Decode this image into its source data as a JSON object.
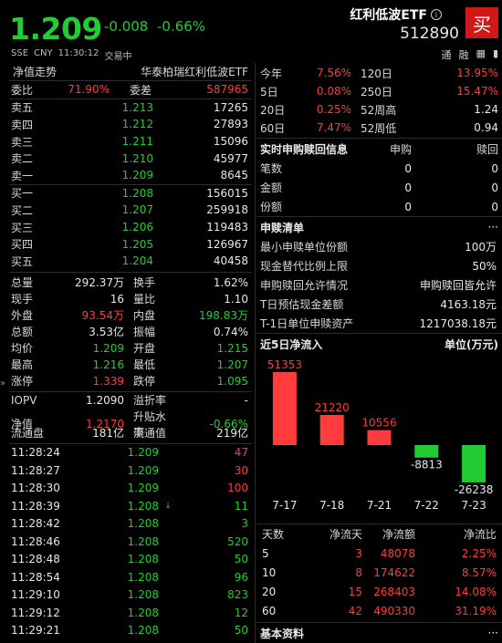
{
  "header": {
    "price": "1.209",
    "change": "-0.008",
    "change_pct": "-0.66%",
    "exchange": "SSE",
    "currency": "CNY",
    "time": "11:30:12",
    "status": "交易中",
    "name": "红利低波ETF",
    "code": "512890",
    "buy_label": "买",
    "icon_tong": "通",
    "icon_rong": "融",
    "up_color": "#ff3b3b",
    "down_color": "#22cc33"
  },
  "left": {
    "tab_title": "净值走势",
    "tab_fund": "华泰柏瑞红利低波ETF",
    "weibi_label": "委比",
    "weibi": "71.90%",
    "weicha_label": "委差",
    "weicha": "587965",
    "asks": [
      {
        "label": "卖五",
        "price": "1.213",
        "vol": "17265"
      },
      {
        "label": "卖四",
        "price": "1.212",
        "vol": "27893"
      },
      {
        "label": "卖三",
        "price": "1.211",
        "vol": "15096"
      },
      {
        "label": "卖二",
        "price": "1.210",
        "vol": "45977"
      },
      {
        "label": "卖一",
        "price": "1.209",
        "vol": "8645"
      }
    ],
    "bids": [
      {
        "label": "买一",
        "price": "1.208",
        "vol": "156015"
      },
      {
        "label": "买二",
        "price": "1.207",
        "vol": "259918"
      },
      {
        "label": "买三",
        "price": "1.206",
        "vol": "119483"
      },
      {
        "label": "买四",
        "price": "1.205",
        "vol": "126967"
      },
      {
        "label": "买五",
        "price": "1.204",
        "vol": "40458"
      }
    ],
    "stats": [
      {
        "l1": "总量",
        "v1": "292.37万",
        "c1": "white",
        "l2": "换手",
        "v2": "1.62%",
        "c2": "white"
      },
      {
        "l1": "现手",
        "v1": "16",
        "c1": "white",
        "l2": "量比",
        "v2": "1.10",
        "c2": "white"
      },
      {
        "l1": "外盘",
        "v1": "93.54万",
        "c1": "red",
        "l2": "内盘",
        "v2": "198.83万",
        "c2": "green"
      },
      {
        "l1": "总额",
        "v1": "3.53亿",
        "c1": "white",
        "l2": "振幅",
        "v2": "0.74%",
        "c2": "white"
      },
      {
        "l1": "均价",
        "v1": "1.209",
        "c1": "green",
        "l2": "开盘",
        "v2": "1.215",
        "c2": "green"
      },
      {
        "l1": "最高",
        "v1": "1.216",
        "c1": "green",
        "l2": "最低",
        "v2": "1.207",
        "c2": "green"
      },
      {
        "l1": "涨停",
        "v1": "1.339",
        "c1": "red",
        "l2": "跌停",
        "v2": "1.095",
        "c2": "green"
      }
    ],
    "stats2": [
      {
        "l1": "IOPV",
        "v1": "1.2090",
        "c1": "white",
        "l2": "溢折率",
        "v2": "-",
        "c2": "white"
      },
      {
        "l1": "净值",
        "v1": "1.2170",
        "c1": "red",
        "l2": "升贴水率",
        "v2": "-0.66%",
        "c2": "green"
      },
      {
        "l1": "流通盘",
        "v1": "181亿",
        "c1": "white",
        "l2": "流通值",
        "v2": "219亿",
        "c2": "white"
      }
    ],
    "ticks": [
      {
        "t": "11:28:24",
        "p": "1.209",
        "a": "",
        "v": "47",
        "vc": "red"
      },
      {
        "t": "11:28:27",
        "p": "1.209",
        "a": "",
        "v": "30",
        "vc": "red"
      },
      {
        "t": "11:28:30",
        "p": "1.209",
        "a": "",
        "v": "100",
        "vc": "red"
      },
      {
        "t": "11:28:39",
        "p": "1.208",
        "a": "↓",
        "v": "11",
        "vc": "green"
      },
      {
        "t": "11:28:42",
        "p": "1.208",
        "a": "",
        "v": "3",
        "vc": "green"
      },
      {
        "t": "11:28:46",
        "p": "1.208",
        "a": "",
        "v": "520",
        "vc": "green"
      },
      {
        "t": "11:28:48",
        "p": "1.208",
        "a": "",
        "v": "50",
        "vc": "green"
      },
      {
        "t": "11:28:54",
        "p": "1.208",
        "a": "",
        "v": "96",
        "vc": "green"
      },
      {
        "t": "11:29:10",
        "p": "1.208",
        "a": "",
        "v": "823",
        "vc": "green"
      },
      {
        "t": "11:29:12",
        "p": "1.208",
        "a": "",
        "v": "12",
        "vc": "green"
      },
      {
        "t": "11:29:21",
        "p": "1.208",
        "a": "",
        "v": "50",
        "vc": "green"
      }
    ]
  },
  "right": {
    "perf": [
      {
        "l1": "今年",
        "v1": "7.56%",
        "c1": "red",
        "l2": "120日",
        "v2": "13.95%",
        "c2": "red"
      },
      {
        "l1": "5日",
        "v1": "0.08%",
        "c1": "red",
        "l2": "250日",
        "v2": "15.47%",
        "c2": "red"
      },
      {
        "l1": "20日",
        "v1": "0.25%",
        "c1": "red",
        "l2": "52周高",
        "v2": "1.24",
        "c2": "white"
      },
      {
        "l1": "60日",
        "v1": "7.47%",
        "c1": "red",
        "l2": "52周低",
        "v2": "0.94",
        "c2": "white"
      }
    ],
    "sr_title": "实时申购赎回信息",
    "sr_col1": "申购",
    "sr_col2": "赎回",
    "sr_rows": [
      {
        "l": "笔数",
        "a": "0",
        "b": "0"
      },
      {
        "l": "金额",
        "a": "0",
        "b": "0"
      },
      {
        "l": "份额",
        "a": "0",
        "b": "0"
      }
    ],
    "list_title": "申赎清单",
    "list_more": "···",
    "list_rows": [
      {
        "k": "最小申赎单位份额",
        "v": "100万"
      },
      {
        "k": "现金替代比例上限",
        "v": "50%"
      },
      {
        "k": "申购赎回允许情况",
        "v": "申购赎回皆允许"
      },
      {
        "k": "T日预估现金差额",
        "v": "4163.18元"
      },
      {
        "k": "T-1日单位申赎资产",
        "v": "1217038.18元"
      }
    ],
    "flow_title": "近5日净流入",
    "flow_unit": "单位(万元)",
    "flow_table_head": [
      "天数",
      "净流天",
      "净流额",
      "净流比"
    ],
    "flow_table": [
      {
        "d": "5",
        "n": "3",
        "a": "48078",
        "p": "2.25%"
      },
      {
        "d": "10",
        "n": "8",
        "a": "174622",
        "p": "8.57%"
      },
      {
        "d": "20",
        "n": "15",
        "a": "268403",
        "p": "14.08%"
      },
      {
        "d": "60",
        "n": "42",
        "a": "490330",
        "p": "31.19%"
      }
    ],
    "basic_title": "基本资料",
    "basic_more": "···"
  },
  "chart_data": {
    "type": "bar",
    "title": "近5日净流入",
    "ylabel": "单位(万元)",
    "categories": [
      "7-17",
      "7-18",
      "7-21",
      "7-22",
      "7-23"
    ],
    "values": [
      51353,
      21220,
      10556,
      -8813,
      -26238
    ],
    "colors": {
      "positive": "#ff3b3b",
      "negative": "#22cc33"
    }
  }
}
